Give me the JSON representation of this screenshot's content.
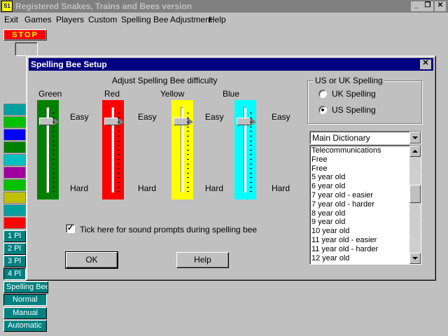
{
  "app": {
    "title": "Registered Snakes, Trains and Bees version",
    "icon_text": "S1"
  },
  "menu": [
    {
      "label": "Exit"
    },
    {
      "label": "Games"
    },
    {
      "label": "Players"
    },
    {
      "label": "Custom"
    },
    {
      "label": "Spelling Bee Adjustment"
    },
    {
      "label": "Help"
    }
  ],
  "side": {
    "stop_label": "STOP",
    "player_buttons": [
      "1 Pl",
      "2 Pl",
      "3 Pl",
      "4 Pl"
    ],
    "mode_buttons": [
      "Spelling Bee",
      "Normal",
      "Manual",
      "Automatic"
    ]
  },
  "dialog": {
    "title": "Spelling Bee Setup",
    "close_glyph": "✕",
    "difficulty_heading": "Adjust Spelling Bee difficulty",
    "sliders": [
      {
        "label": "Green",
        "color": "#008000",
        "easy": "Easy",
        "hard": "Hard"
      },
      {
        "label": "Red",
        "color": "#ff0000",
        "easy": "Easy",
        "hard": "Hard"
      },
      {
        "label": "Yellow",
        "color": "#ffff00",
        "easy": "Easy",
        "hard": "Hard"
      },
      {
        "label": "Blue",
        "color": "#00ffff",
        "easy": "Easy",
        "hard": "Hard"
      }
    ],
    "sound_checkbox": {
      "label": "Tick here for sound prompts during spelling bee",
      "checked": true,
      "mark": "✓"
    },
    "ok_label": "OK",
    "help_label": "Help",
    "spelling_group": {
      "title": "US or UK Spelling",
      "options": [
        {
          "label": "UK Spelling",
          "checked": false
        },
        {
          "label": "US Spelling",
          "checked": true
        }
      ]
    },
    "dictionary": {
      "selected": "Main Dictionary",
      "items": [
        "Telecommunications",
        "Free",
        "Free",
        "5 year old",
        "6 year old",
        "7 year old - easier",
        "7 year old - harder",
        "8 year old",
        "9 year old",
        "10 year old",
        "11 year old - easier",
        "11 year old - harder",
        "12 year old"
      ]
    }
  }
}
